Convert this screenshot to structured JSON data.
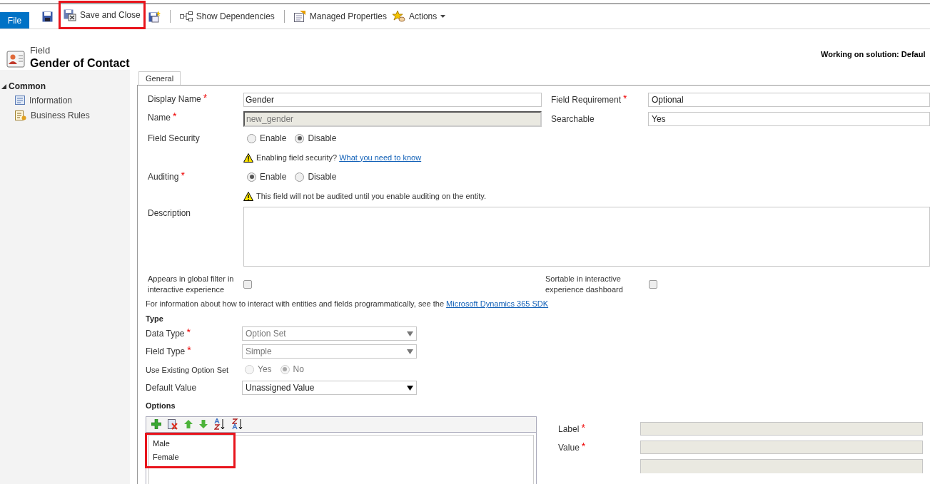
{
  "toolbar": {
    "file_button": "File",
    "items": [
      {
        "kind": "save"
      },
      {
        "kind": "saveclose",
        "label": "Save and Close",
        "highlighted": true
      },
      {
        "kind": "savenew"
      },
      {
        "kind": "separator"
      },
      {
        "kind": "dependencies",
        "label": "Show Dependencies"
      },
      {
        "kind": "separator"
      },
      {
        "kind": "properties",
        "label": "Managed Properties"
      },
      {
        "kind": "actions",
        "label": "Actions"
      }
    ]
  },
  "header": {
    "entity_type": "Field",
    "title": "Gender of Contact",
    "solution": "Working on solution: Defaul"
  },
  "sidebar": {
    "groups": [
      {
        "label": "Common",
        "expanded": true,
        "items": [
          {
            "kind": "info",
            "label": "Information"
          },
          {
            "kind": "rules",
            "label": "Business Rules"
          }
        ]
      }
    ]
  },
  "tab": {
    "label": "General",
    "selected": true
  },
  "general": {
    "display_name": {
      "label": "Display Name",
      "required_mark": "*",
      "value": "Gender",
      "disabled": false
    },
    "field_requirement": {
      "label": "Field Requirement",
      "required_mark": "*",
      "value": "Optional"
    },
    "name": {
      "label": "Name",
      "required_mark": "*",
      "value": "new_gender",
      "disabled": true
    },
    "searchable": {
      "label": "Searchable",
      "value": "Yes"
    },
    "field_security": {
      "label": "Field Security",
      "options": [
        {
          "label": "Enable",
          "selected": false
        },
        {
          "label": "Disable",
          "selected": true
        }
      ],
      "warning": "Enabling field security?",
      "warning_link": "What you need to know"
    },
    "auditing": {
      "label": "Auditing",
      "required_mark": "*",
      "options": [
        {
          "label": "Enable",
          "selected": true
        },
        {
          "label": "Disable",
          "selected": false
        }
      ],
      "warning": "This field will not be audited until you enable auditing on the entity."
    },
    "description": {
      "label": "Description"
    },
    "global_filter": {
      "label": "Appears in global filter in interactive experience",
      "checked": false
    },
    "sortable": {
      "label": "Sortable in interactive experience dashboard",
      "checked": false
    },
    "info": {
      "text": "For information about how to interact with entities and fields programmatically, see the",
      "link": "Microsoft Dynamics 365 SDK"
    }
  },
  "type_section": {
    "title": "Type",
    "data_type": {
      "label": "Data Type",
      "required_mark": "*",
      "value": "Option Set",
      "disabled": true
    },
    "field_type": {
      "label": "Field Type",
      "required_mark": "*",
      "value": "Simple",
      "disabled": true
    },
    "existing_option_set": {
      "label": "Use Existing Option Set",
      "disabled": true,
      "options": [
        {
          "label": "Yes",
          "selected": false
        },
        {
          "label": "No",
          "selected": true
        }
      ]
    },
    "default_value": {
      "label": "Default Value",
      "value": "Unassigned Value",
      "disabled": false
    }
  },
  "options_section": {
    "title": "Options",
    "highlighted": true,
    "tools": [
      {
        "kind": "add"
      },
      {
        "kind": "delete"
      },
      {
        "kind": "up"
      },
      {
        "kind": "down"
      },
      {
        "kind": "sortaz"
      },
      {
        "kind": "sortza"
      }
    ],
    "items": [
      {
        "label": "Male"
      },
      {
        "label": "Female"
      }
    ],
    "label_field": {
      "label": "Label",
      "required_mark": "*"
    },
    "value_field": {
      "label": "Value",
      "required_mark": "*"
    }
  }
}
